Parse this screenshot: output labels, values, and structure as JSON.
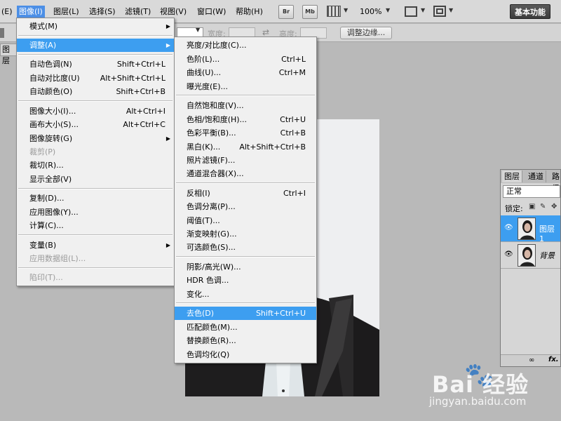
{
  "menubar": {
    "items": [
      "(E)",
      "图像(I)",
      "图层(L)",
      "选择(S)",
      "滤镜(T)",
      "视图(V)",
      "窗口(W)",
      "帮助(H)"
    ],
    "br": "Br",
    "mb": "Mb",
    "zoom": "100%",
    "workspace": "基本功能"
  },
  "options": {
    "width_label": "宽度:",
    "height_label": "高度:",
    "refine_edge": "调整边缘..."
  },
  "doc_tab": "图层",
  "image_menu": {
    "items": [
      {
        "label": "模式(M)",
        "shortcut": ""
      },
      {
        "label": "调整(A)",
        "shortcut": ""
      },
      {
        "label": "自动色调(N)",
        "shortcut": "Shift+Ctrl+L"
      },
      {
        "label": "自动对比度(U)",
        "shortcut": "Alt+Shift+Ctrl+L"
      },
      {
        "label": "自动颜色(O)",
        "shortcut": "Shift+Ctrl+B"
      },
      {
        "label": "图像大小(I)...",
        "shortcut": "Alt+Ctrl+I"
      },
      {
        "label": "画布大小(S)...",
        "shortcut": "Alt+Ctrl+C"
      },
      {
        "label": "图像旋转(G)",
        "shortcut": ""
      },
      {
        "label": "裁剪(P)",
        "shortcut": ""
      },
      {
        "label": "裁切(R)...",
        "shortcut": ""
      },
      {
        "label": "显示全部(V)",
        "shortcut": ""
      },
      {
        "label": "复制(D)...",
        "shortcut": ""
      },
      {
        "label": "应用图像(Y)...",
        "shortcut": ""
      },
      {
        "label": "计算(C)...",
        "shortcut": ""
      },
      {
        "label": "变量(B)",
        "shortcut": ""
      },
      {
        "label": "应用数据组(L)...",
        "shortcut": ""
      },
      {
        "label": "陷印(T)...",
        "shortcut": ""
      }
    ]
  },
  "adjust_menu": {
    "items": [
      {
        "label": "亮度/对比度(C)...",
        "shortcut": ""
      },
      {
        "label": "色阶(L)...",
        "shortcut": "Ctrl+L"
      },
      {
        "label": "曲线(U)...",
        "shortcut": "Ctrl+M"
      },
      {
        "label": "曝光度(E)...",
        "shortcut": ""
      },
      {
        "label": "自然饱和度(V)...",
        "shortcut": ""
      },
      {
        "label": "色相/饱和度(H)...",
        "shortcut": "Ctrl+U"
      },
      {
        "label": "色彩平衡(B)...",
        "shortcut": "Ctrl+B"
      },
      {
        "label": "黑白(K)...",
        "shortcut": "Alt+Shift+Ctrl+B"
      },
      {
        "label": "照片滤镜(F)...",
        "shortcut": ""
      },
      {
        "label": "通道混合器(X)...",
        "shortcut": ""
      },
      {
        "label": "反相(I)",
        "shortcut": "Ctrl+I"
      },
      {
        "label": "色调分离(P)...",
        "shortcut": ""
      },
      {
        "label": "阈值(T)...",
        "shortcut": ""
      },
      {
        "label": "渐变映射(G)...",
        "shortcut": ""
      },
      {
        "label": "可选颜色(S)...",
        "shortcut": ""
      },
      {
        "label": "阴影/高光(W)...",
        "shortcut": ""
      },
      {
        "label": "HDR 色调...",
        "shortcut": ""
      },
      {
        "label": "变化...",
        "shortcut": ""
      },
      {
        "label": "去色(D)",
        "shortcut": "Shift+Ctrl+U"
      },
      {
        "label": "匹配颜色(M)...",
        "shortcut": ""
      },
      {
        "label": "替换颜色(R)...",
        "shortcut": ""
      },
      {
        "label": "色调均化(Q)",
        "shortcut": ""
      }
    ]
  },
  "layers_panel": {
    "tabs": [
      "图层",
      "通道",
      "路径"
    ],
    "blend_mode": "正常",
    "lock_label": "锁定:",
    "layers": [
      {
        "name": "图层 1"
      },
      {
        "name": "背景"
      }
    ],
    "footer_fx": "fx."
  },
  "watermark": {
    "logo": "Bai 经验",
    "url": "jingyan.baidu.com"
  }
}
